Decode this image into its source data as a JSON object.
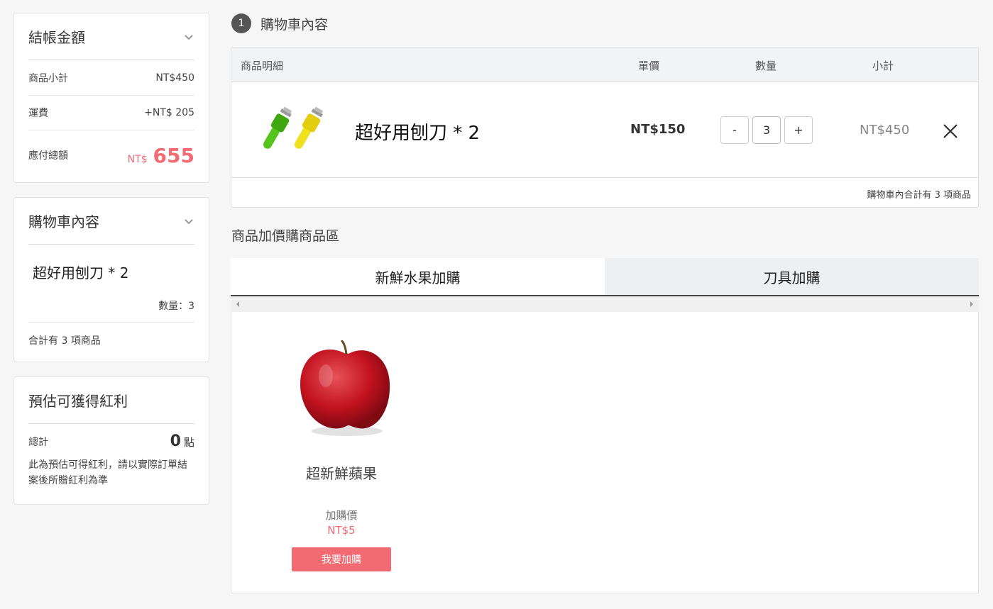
{
  "checkout": {
    "title": "結帳金額",
    "subtotal_label": "商品小計",
    "subtotal_value": "NT$450",
    "shipping_label": "運費",
    "shipping_value": "+NT$ 205",
    "total_label": "應付總額",
    "total_currency": "NT$",
    "total_value": "655"
  },
  "cart_summary": {
    "title": "購物車內容",
    "item_name": "超好用刨刀 * 2",
    "qty_text": "數量：3",
    "footer_text": "合計有 3 項商品"
  },
  "bonus": {
    "title": "預估可獲得紅利",
    "total_label": "總計",
    "points": "0",
    "points_unit": "點",
    "note": "此為預估可得紅利，請以實際訂單結案後所贈紅利為準"
  },
  "step": {
    "number": "1",
    "title": "購物車內容"
  },
  "cart_table": {
    "col_detail": "商品明細",
    "col_price": "單價",
    "col_qty": "數量",
    "col_subtotal": "小計",
    "item_name": "超好用刨刀 * 2",
    "item_price": "NT$150",
    "minus_label": "-",
    "qty_value": "3",
    "plus_label": "+",
    "item_subtotal": "NT$450",
    "remove_icon": "close-icon",
    "footer_text": "購物車內合計有 3 項商品"
  },
  "addon": {
    "section_title": "商品加價購商品區",
    "tabs": [
      {
        "label": "新鮮水果加購"
      },
      {
        "label": "刀具加購"
      }
    ],
    "product_name": "超新鮮蘋果",
    "price_label": "加購價",
    "price_value": "NT$5",
    "button_label": "我要加購"
  },
  "colors": {
    "accent": "#f26b73",
    "tab_underline": "#444444"
  }
}
